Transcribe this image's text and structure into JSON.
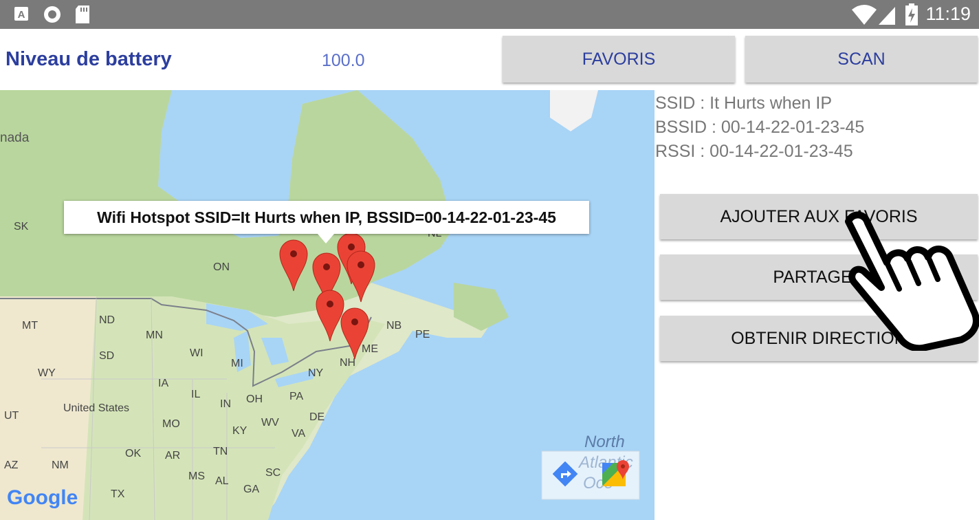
{
  "status_bar": {
    "time": "11:19",
    "left_icons": [
      "a-letter-icon",
      "circle-record-icon",
      "sd-card-icon"
    ],
    "right_icons": [
      "wifi-icon",
      "signal-icon",
      "battery-charging-icon"
    ]
  },
  "header": {
    "battery_label": "Niveau de battery",
    "battery_value": "100.0",
    "favoris_button": "FAVORIS",
    "scan_button": "SCAN"
  },
  "hotspot": {
    "ssid": "SSID : It Hurts when IP",
    "bssid": "BSSID : 00-14-22-01-23-45",
    "rssi": "RSSI : 00-14-22-01-23-45"
  },
  "actions": {
    "add_favorites": "AJOUTER AUX FAVORIS",
    "share": "PARTAGER",
    "get_direction": "OBTENIR DIRECTION"
  },
  "map": {
    "tooltip": "Wifi Hotspot SSID=It Hurts when IP, BSSID=00-14-22-01-23-45",
    "markers": [
      "marker-1",
      "marker-2",
      "marker-3",
      "marker-4",
      "marker-5",
      "marker-6"
    ],
    "labels": {
      "canada": "nada",
      "on": "ON",
      "nl": "NL",
      "mt": "MT",
      "nd": "ND",
      "mn": "MN",
      "sd": "SD",
      "wy": "WY",
      "wi": "WI",
      "mi": "MI",
      "ny": "NY",
      "nb": "NB",
      "pe": "PE",
      "me": "ME",
      "nh": "NH",
      "ia": "IA",
      "il": "IL",
      "oh": "OH",
      "pa": "PA",
      "ut": "UT",
      "us": "United States",
      "in": "IN",
      "wv": "WV",
      "de": "DE",
      "mo": "MO",
      "ky": "KY",
      "va": "VA",
      "ok": "OK",
      "tn": "TN",
      "ar": "AR",
      "az": "AZ",
      "nm": "NM",
      "ms": "MS",
      "al": "AL",
      "sc": "SC",
      "tx": "TX",
      "ga": "GA",
      "sk": "SK",
      "ocean_1": "North",
      "ocean_2": "Atlantic",
      "ocean_3": "Oce",
      "google": "Google"
    },
    "colors": {
      "water": "#a8d4f6",
      "land": "#dfe8c8",
      "forest": "#b9d69e",
      "marker": "#ea4335"
    }
  }
}
